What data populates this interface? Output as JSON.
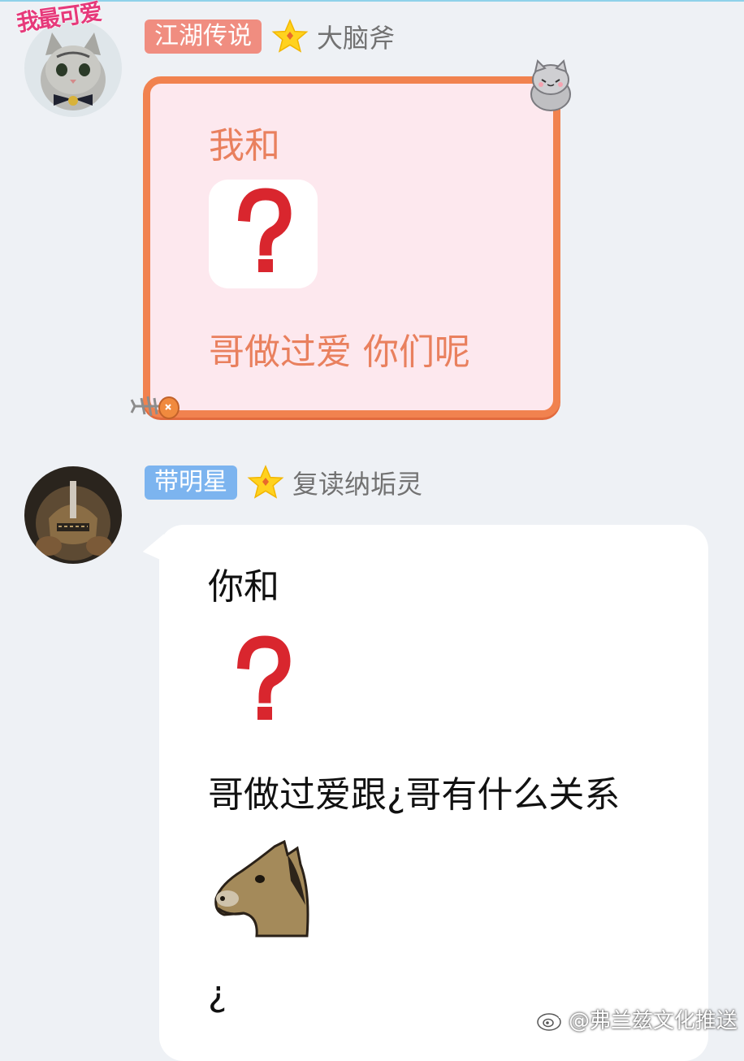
{
  "messages": [
    {
      "badge": "江湖传说",
      "nickname": "大脑斧",
      "avatar_tag": "我最可爱",
      "avatar": "cat-avatar",
      "lines": [
        "我和",
        "哥做过爱  你们呢"
      ],
      "sticker": "question-mark-sticker"
    },
    {
      "badge": "带明星",
      "nickname": "复读纳垢灵",
      "avatar": "armored-warrior-avatar",
      "lines": [
        "你和",
        "哥做过爱跟¿哥有什么关系",
        "¿"
      ],
      "stickers": [
        "question-mark-sticker",
        "horse-head-sticker"
      ]
    }
  ],
  "watermark": "@弗兰兹文化推送",
  "colors": {
    "background": "#eef1f5",
    "badge_pink": "#f08d80",
    "badge_blue": "#7cb4ef",
    "bubble_pink_border": "#f1824f",
    "bubble_pink_fill": "#fde8ee",
    "bubble_pink_text": "#e9805e",
    "star": "#ffd21f"
  }
}
